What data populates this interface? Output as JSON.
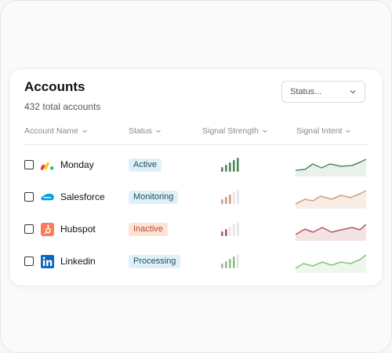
{
  "accounts": {
    "title": "Accounts",
    "subtitle": "432 total accounts",
    "status_placeholder": "Status...",
    "columns": [
      "Account Name",
      "Status",
      "Signal Strength",
      "Signal Intent"
    ],
    "rows": [
      {
        "name": "Monday",
        "status": "Active",
        "status_bg": "#dff1f7",
        "status_fg": "#1f4e63",
        "strength": 5,
        "color": "#4e8a5c",
        "fill": "#e3efe5",
        "logo": "monday-logo-icon"
      },
      {
        "name": "Salesforce",
        "status": "Monitoring",
        "status_bg": "#dff1f7",
        "status_fg": "#1f4e63",
        "strength": 3,
        "color": "#d49b78",
        "fill": "#f6e8df",
        "logo": "salesforce-logo-icon"
      },
      {
        "name": "Hubspot",
        "status": "Inactive",
        "status_bg": "#fde3d6",
        "status_fg": "#b4482a",
        "strength": 2,
        "color": "#b5585c",
        "fill": "#f3dcdc",
        "logo": "hubspot-logo-icon"
      },
      {
        "name": "Linkedin",
        "status": "Processing",
        "status_bg": "#dff1f7",
        "status_fg": "#1f4e63",
        "strength": 4,
        "color": "#88c47e",
        "fill": "#eaf5e7",
        "logo": "linkedin-logo-icon"
      }
    ]
  }
}
